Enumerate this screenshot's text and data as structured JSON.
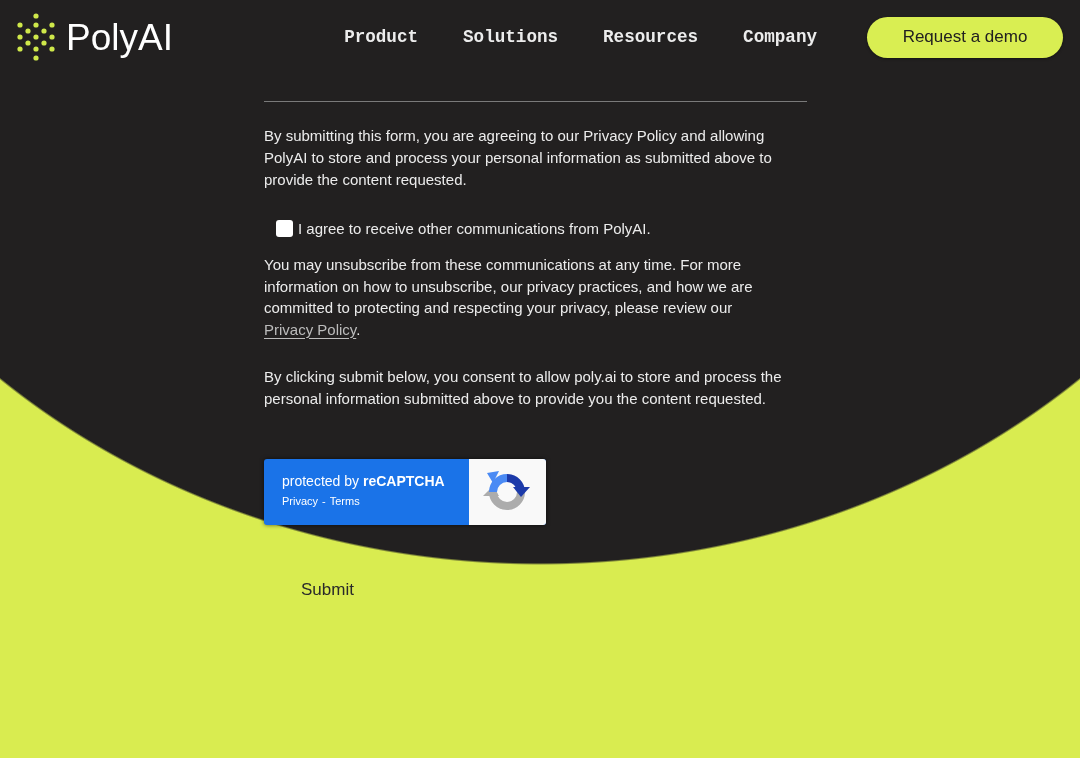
{
  "header": {
    "logo_text": "PolyAI",
    "nav": [
      {
        "label": "Product"
      },
      {
        "label": "Solutions"
      },
      {
        "label": "Resources"
      },
      {
        "label": "Company"
      }
    ],
    "cta": "Request a demo"
  },
  "form": {
    "consent_text": "By submitting this form, you are agreeing to our Privacy Policy and allowing PolyAI to store and process your personal information as submitted above to provide the content requested.",
    "communications": {
      "label": "I agree to receive other communications from PolyAI.",
      "checked": false
    },
    "unsubscribe": {
      "text": "You may unsubscribe from these communications at any time. For more information on how to unsubscribe, our privacy practices, and how we are committed to protecting and respecting your privacy, please review our",
      "link": "Privacy Policy",
      "after": "."
    },
    "submit_consent_text": "By clicking submit below, you consent to allow poly.ai to store and process the personal information submitted above to provide you the content requested.",
    "recaptcha": {
      "title": "protected by **reCAPTCHA**",
      "links": [
        "Privacy",
        "Terms"
      ],
      "separator": "-"
    },
    "submit_label": "Submit"
  }
}
